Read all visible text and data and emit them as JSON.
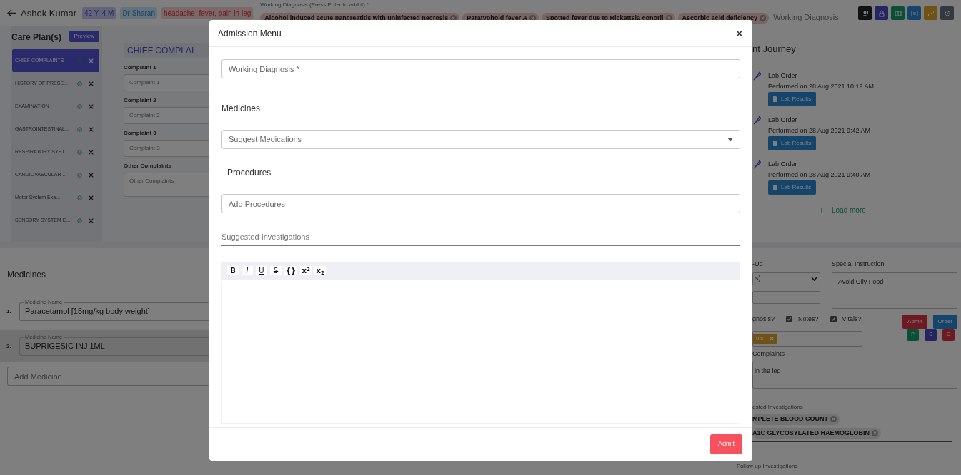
{
  "header": {
    "patient_name": "Ashok Kumar",
    "age_badge": "42 Y, 4 M",
    "doctor_badge": "Dr Sharan",
    "complaints_badge": "headache, fever, pain in leg",
    "diagnosis_label": "Working Diagnosis (Press Enter to add it) *",
    "diagnosis_chips": [
      "Alcohol induced acute pancreatitis with uninfected necrosis",
      "Paratyphoid fever A",
      "Spotted fever due to Rickettsia conorii",
      "Ascorbic acid deficiency"
    ],
    "diagnosis_placeholder": "Working Diagnosis",
    "toolbar_buttons": [
      {
        "kind": "user"
      },
      {
        "kind": "lock"
      },
      {
        "kind": "book"
      },
      {
        "kind": "card"
      },
      {
        "kind": "link"
      },
      {
        "kind": "settings"
      }
    ]
  },
  "care_plan": {
    "title": "Care Plan(s)",
    "preview_button": "Preview",
    "items": [
      {
        "label": "CHIEF COMPLAINTS",
        "selected": true
      },
      {
        "label": "HISTORY OF PRESE...",
        "selected": false
      },
      {
        "label": "EXAMINATION",
        "selected": false
      },
      {
        "label": "GASTROINTESTINAL...",
        "selected": false
      },
      {
        "label": "RESPIRATORY SYST...",
        "selected": false
      },
      {
        "label": "CARDIOVASCULAR ...",
        "selected": false
      },
      {
        "label": "Motor System Exa...",
        "selected": false
      },
      {
        "label": "SENSORY SYSTEM E...",
        "selected": false
      }
    ]
  },
  "chief_complaints": {
    "heading": "CHIEF COMPLAI",
    "fields": [
      {
        "label": "Complaint 1",
        "placeholder": "Complaint 1",
        "kind": "input"
      },
      {
        "label": "Complaint 2",
        "placeholder": "Complaint 2",
        "kind": "input"
      },
      {
        "label": "Complaint 3",
        "placeholder": "Complaint 3",
        "kind": "input"
      },
      {
        "label": "Other Complaints",
        "placeholder": "Other Complaints",
        "kind": "textarea"
      }
    ]
  },
  "journey": {
    "title": "nt Journey",
    "entries": [
      {
        "title": "Lab Order",
        "performed": "Performed on 28 Aug 2021 10:19 AM",
        "button": "Lab Results"
      },
      {
        "title": "Lab Order",
        "performed": "Performed on 28 Aug 2021 9:42 AM",
        "button": "Lab Results"
      },
      {
        "title": "Lab Order",
        "performed": "Performed on 28 Aug 2021 9:40 AM",
        "button": "Lab Results"
      }
    ],
    "load_more": "Load more"
  },
  "medicines": {
    "title": "Medicines",
    "rows": [
      {
        "number": "1.",
        "legend": "Medicine Name",
        "value": "Paracetamol [15mg/kg body weight]",
        "selected": false
      },
      {
        "number": "2.",
        "legend": "Medicine Name",
        "value": "BUPRIGESIC INJ 1ML",
        "selected": true
      }
    ],
    "add_placeholder": "Add Medicine"
  },
  "right_form": {
    "follow_label": "-Up",
    "follow_select": "s)",
    "special_label": "Special Instruction",
    "special_value": "Avoid Oily Food",
    "diagnosis_fragment": "gnosis?",
    "checkboxes": [
      {
        "label": "Notes?",
        "checked": true
      },
      {
        "label": "Vitals?",
        "checked": true
      }
    ],
    "action_buttons": [
      {
        "label": "Admit",
        "kind": "danger"
      },
      {
        "label": "Order",
        "kind": "primary"
      }
    ],
    "small_buttons": [
      {
        "label": "P",
        "kind": "success"
      },
      {
        "label": "S",
        "kind": "indigo"
      },
      {
        "label": "C",
        "kind": "danger"
      }
    ],
    "tag": {
      "label": "uts"
    },
    "complaints_label": "Complaints",
    "complaints_value": "in the leg",
    "investigations_label": "ested Investigations",
    "investigation_chips": [
      "MPLETE BLOOD COUNT",
      "A1C GLYCOSYLATED HAEMOGLOBIN"
    ],
    "follow_investigations_label": "Follow up Investigations"
  },
  "modal": {
    "title": "Admission Menu",
    "close": "×",
    "working_diagnosis_placeholder": "Working Diagnosis *",
    "medicines_heading": "Medicines",
    "medication_placeholder": "Suggest Medications",
    "procedures_heading": "Procedures",
    "procedures_placeholder": "Add Procedures",
    "investigations_placeholder": "Suggested Investigations",
    "toolbar": [
      {
        "label": "B",
        "kind": "bold"
      },
      {
        "label": "I",
        "kind": "italic"
      },
      {
        "label": "U",
        "kind": "underline"
      },
      {
        "label": "S",
        "kind": "strike"
      },
      {
        "label": "{}",
        "kind": "code"
      },
      {
        "label": "x$^{2}$",
        "kind": "superscript"
      },
      {
        "label": "x$_{2}$",
        "kind": "subscript"
      }
    ],
    "submit": "Admit"
  }
}
